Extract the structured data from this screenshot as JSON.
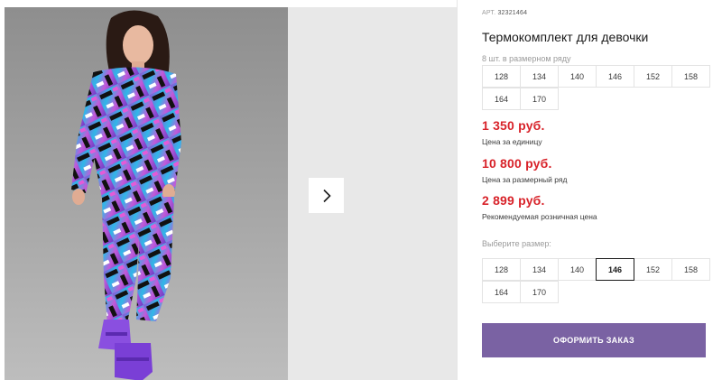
{
  "product": {
    "sku_label": "АРТ.",
    "sku_value": "32321464",
    "title": "Термокомплект для девочки"
  },
  "size_row": {
    "label": "8 шт. в размерном ряду",
    "sizes": [
      "128",
      "134",
      "140",
      "146",
      "152",
      "158",
      "164",
      "170"
    ]
  },
  "prices": [
    {
      "value": "1 350 руб.",
      "caption": "Цена за единицу"
    },
    {
      "value": "10 800 руб.",
      "caption": "Цена за размерный ряд"
    },
    {
      "value": "2 899 руб.",
      "caption": "Рекомендуемая розничная цена"
    }
  ],
  "size_picker": {
    "label": "Выберите размер:",
    "sizes": [
      "128",
      "134",
      "140",
      "146",
      "152",
      "158",
      "164",
      "170"
    ],
    "selected": "146"
  },
  "order_button": {
    "label": "ОФОРМИТЬ ЗАКАЗ"
  },
  "gallery": {
    "next_icon": "chevron-right-icon"
  },
  "colors": {
    "price": "#d8232a",
    "button": "#7a62a3"
  }
}
